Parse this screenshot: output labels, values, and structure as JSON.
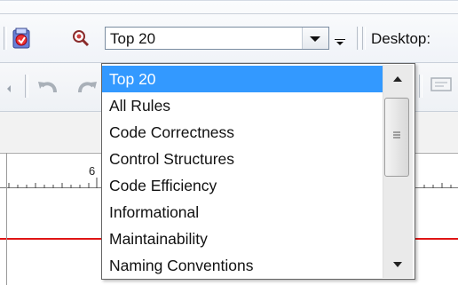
{
  "toolbar": {
    "rule_set_combo": {
      "value": "Top 20"
    },
    "desktop_label": "Desktop:"
  },
  "ruler": {
    "tick_label": "6"
  },
  "dropdown": {
    "selected_index": 0,
    "options": [
      "Top 20",
      "All Rules",
      "Code Correctness",
      "Control Structures",
      "Code Efficiency",
      "Informational",
      "Maintainability",
      "Naming Conventions"
    ],
    "scroll_position": 0.18
  },
  "colors": {
    "selection": "#3399ff",
    "red_line": "#e01515"
  },
  "icons": {
    "rules": "rules-icon",
    "zoom": "zoom-icon",
    "undo": "undo-icon",
    "redo": "redo-icon",
    "combo_arrow": "chevron-down-icon",
    "toolbar_overflow": "toolbar-overflow-icon"
  }
}
